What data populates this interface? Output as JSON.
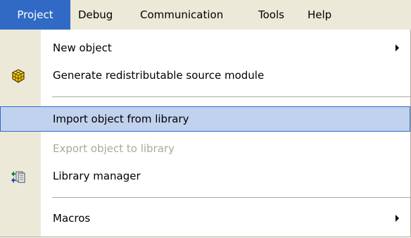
{
  "menubar": {
    "items": [
      {
        "label": "Project",
        "active": true
      },
      {
        "label": "Debug",
        "active": false
      },
      {
        "label": "Communication",
        "active": false
      },
      {
        "label": "Tools",
        "active": false
      },
      {
        "label": "Help",
        "active": false
      }
    ]
  },
  "dropdown": {
    "items": [
      {
        "label": "New object",
        "icon": "",
        "submenu": true,
        "enabled": true,
        "highlighted": false
      },
      {
        "label": "Generate redistributable source module",
        "icon": "cube-icon",
        "submenu": false,
        "enabled": true,
        "highlighted": false
      },
      {
        "label": "Import object from library",
        "icon": "",
        "submenu": false,
        "enabled": true,
        "highlighted": true
      },
      {
        "label": "Export object to library",
        "icon": "",
        "submenu": false,
        "enabled": false,
        "highlighted": false
      },
      {
        "label": "Library manager",
        "icon": "library-manager-icon",
        "submenu": false,
        "enabled": true,
        "highlighted": false
      },
      {
        "label": "Macros",
        "icon": "",
        "submenu": true,
        "enabled": true,
        "highlighted": false
      }
    ]
  },
  "colors": {
    "menu_face": "#ece9d8",
    "selection": "#316ac5",
    "hover_fill": "#c1d2ee",
    "disabled_text": "#aca899"
  }
}
